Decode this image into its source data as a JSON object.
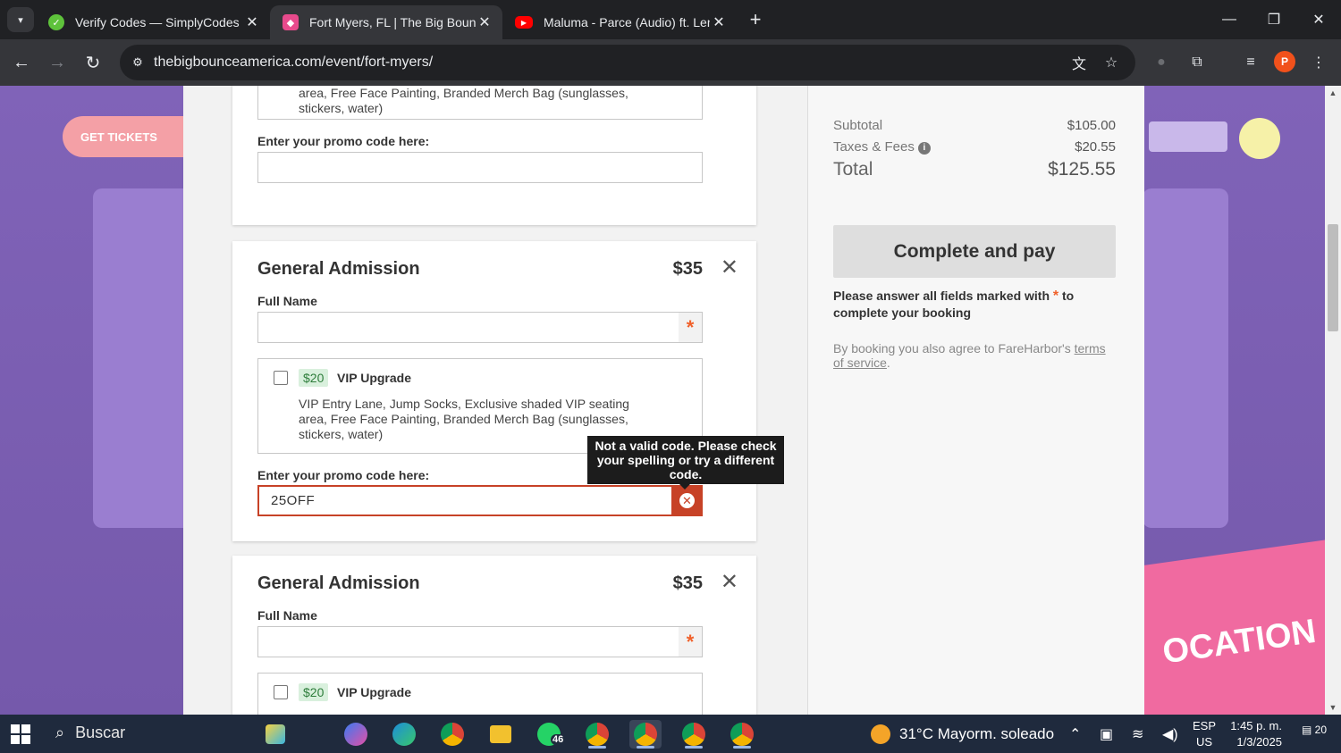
{
  "browser": {
    "tabs": [
      {
        "title": "Verify Codes — SimplyCodes",
        "active": false,
        "favicon_color": "#5ec23b"
      },
      {
        "title": "Fort Myers, FL | The Big Bounce",
        "active": true,
        "favicon_color": "#e74a8c"
      },
      {
        "title": "Maluma - Parce (Audio) ft. Lenn",
        "active": false,
        "favicon_color": "#ff0000"
      }
    ],
    "url": "thebigbounceamerica.com/event/fort-myers/",
    "profile_initial": "P"
  },
  "background_site": {
    "get_tickets_label": "GET TICKETS",
    "banner_text": "OCATION •"
  },
  "booking": {
    "top_card": {
      "upgrade_desc": "VIP Entry Lane, Jump Socks, Exclusive shaded VIP seating area, Free Face Painting, Branded Merch Bag (sunglasses, stickers, water)",
      "promo_label": "Enter your promo code here:",
      "promo_value": ""
    },
    "middle_card": {
      "title": "General Admission",
      "price": "$35",
      "full_name_label": "Full Name",
      "full_name_value": "",
      "upgrade_price": "$20",
      "upgrade_title": "VIP Upgrade",
      "upgrade_desc": "VIP Entry Lane, Jump Socks, Exclusive shaded VIP seating area, Free Face Painting, Branded Merch Bag (sunglasses, stickers, water)",
      "promo_label": "Enter your promo code here:",
      "promo_value": "25OFF",
      "promo_error": "Not a valid code. Please check your spelling or try a different code."
    },
    "bottom_card": {
      "title": "General Admission",
      "price": "$35",
      "full_name_label": "Full Name",
      "full_name_value": "",
      "upgrade_price": "$20",
      "upgrade_title": "VIP Upgrade"
    },
    "summary": {
      "subtotal_label": "Subtotal",
      "subtotal_value": "$105.00",
      "taxes_label": "Taxes & Fees",
      "taxes_value": "$20.55",
      "total_label": "Total",
      "total_value": "$125.55",
      "pay_button": "Complete and pay",
      "warning_pre": "Please answer all fields marked with",
      "warning_post": "to complete your booking",
      "agree_pre": "By booking you also agree to FareHarbor's",
      "agree_link": "terms of service",
      "agree_post": "."
    }
  },
  "taskbar": {
    "search_label": "Buscar",
    "whatsapp_badge": "46",
    "weather": "31°C  Mayorm. soleado",
    "lang_top": "ESP",
    "lang_bottom": "US",
    "time": "1:45 p. m.",
    "date": "1/3/2025",
    "notifications": "20"
  }
}
